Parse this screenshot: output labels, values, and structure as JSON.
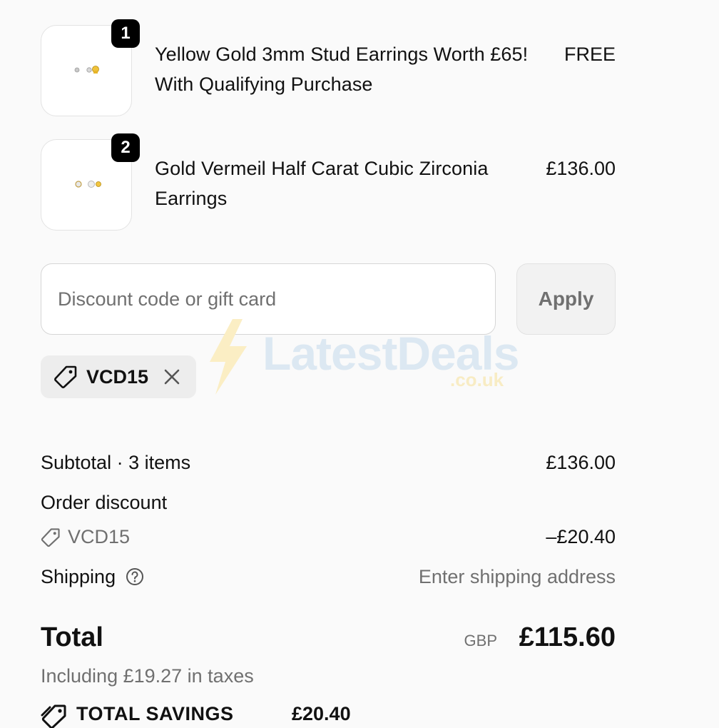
{
  "items": [
    {
      "quantity": "1",
      "name": "Yellow Gold 3mm Stud Earrings Worth £65! With Qualifying Purchase",
      "price": "FREE",
      "image_icon": "stud-earrings-image"
    },
    {
      "quantity": "2",
      "name": "Gold Vermeil Half Carat Cubic Zirconia Earrings",
      "price": "£136.00",
      "image_icon": "cz-earrings-image"
    }
  ],
  "discount": {
    "placeholder": "Discount code or gift card",
    "apply_label": "Apply",
    "applied_code": "VCD15"
  },
  "watermark": {
    "main": "LatestDeals",
    "sub": ".co.uk"
  },
  "summary": {
    "subtotal_label": "Subtotal · 3 items",
    "subtotal_value": "£136.00",
    "order_discount_label": "Order discount",
    "discount_code": "VCD15",
    "discount_value": "–£20.40",
    "shipping_label": "Shipping",
    "shipping_value": "Enter shipping address",
    "total_label": "Total",
    "currency": "GBP",
    "total_value": "£115.60",
    "taxes_note": "Including £19.27 in taxes",
    "savings_label": "TOTAL SAVINGS",
    "savings_value": "£20.40"
  },
  "colors": {
    "background": "#fafafa",
    "text": "#111111",
    "muted": "#707070",
    "badge": "#000000"
  }
}
